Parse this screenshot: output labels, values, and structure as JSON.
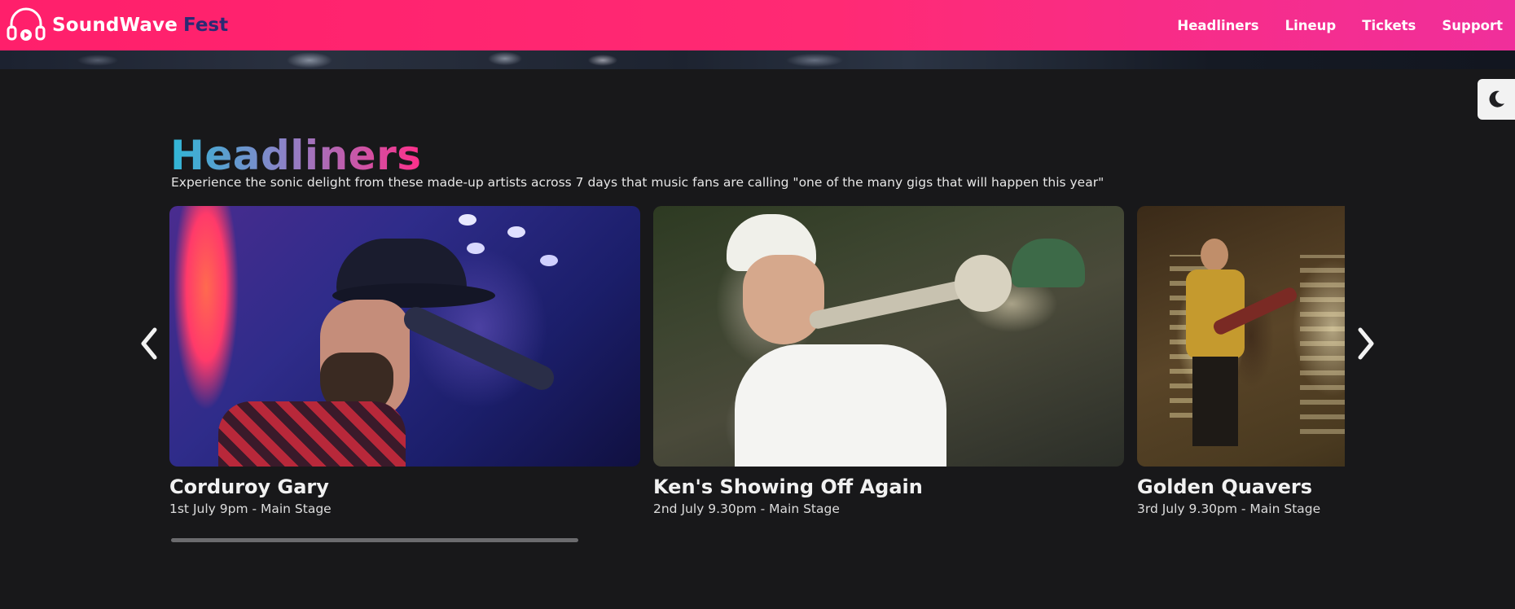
{
  "brand": {
    "name": "SoundWave",
    "accent": "Fest"
  },
  "nav": {
    "items": [
      "Headliners",
      "Lineup",
      "Tickets",
      "Support"
    ]
  },
  "theme_toggle": {
    "icon": "moon-icon"
  },
  "section": {
    "title": "Headliners",
    "subtitle": "Experience the sonic delight from these made-up artists across 7 days that music fans are calling \"one of the many gigs that will happen this year\""
  },
  "headliners": [
    {
      "name": "Corduroy Gary",
      "details": "1st July 9pm - Main Stage"
    },
    {
      "name": "Ken's Showing Off Again",
      "details": "2nd July 9.30pm - Main Stage"
    },
    {
      "name": "Golden Quavers",
      "details": "3rd July 9.30pm - Main Stage"
    }
  ],
  "controls": {
    "prev_icon": "chevron-left-icon",
    "next_icon": "chevron-right-icon"
  },
  "colors": {
    "header_start": "#ff1f6b",
    "header_end": "#f02f9b",
    "accent_text": "#2b2a73",
    "background": "#18181a"
  }
}
